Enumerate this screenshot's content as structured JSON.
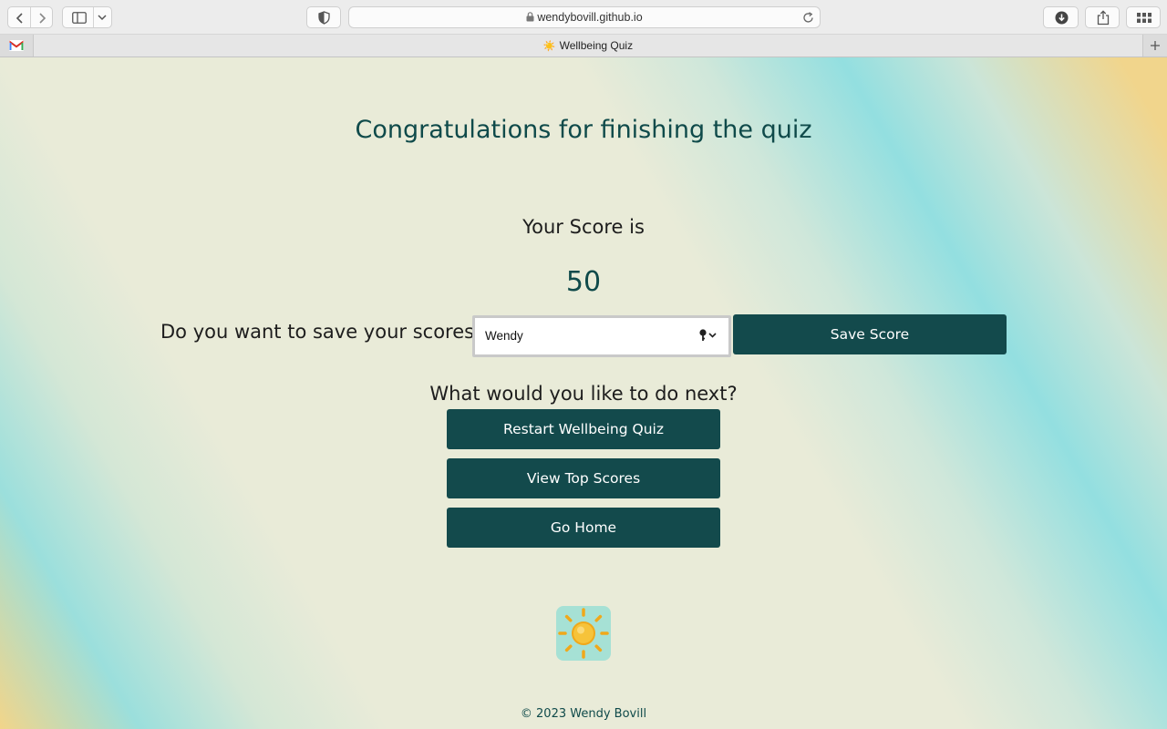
{
  "browser": {
    "url": "wendybovill.github.io",
    "tab_title": "Wellbeing Quiz",
    "tab_favicon": "☀️"
  },
  "quiz": {
    "heading": "Congratulations for finishing the quiz",
    "score_label": "Your Score is",
    "score_value": "50",
    "save_prompt": "Do you want to save your scores?",
    "name_value": "Wendy",
    "save_button": "Save Score",
    "next_label": "What would you like to do next?",
    "restart_button": "Restart Wellbeing Quiz",
    "top_scores_button": "View Top Scores",
    "home_button": "Go Home"
  },
  "footer": {
    "copyright": "© 2023 Wendy Bovill"
  },
  "icons": [
    "back-icon",
    "forward-icon",
    "sidebar-icon",
    "chevron-down-icon",
    "shield-icon",
    "lock-icon",
    "reload-icon",
    "download-icon",
    "share-icon",
    "tab-overview-icon",
    "gmail-icon",
    "new-tab-icon",
    "key-icon",
    "sun-icon"
  ],
  "colors": {
    "primary": "#134a4c",
    "heading": "#0f4a4a",
    "background": "#e9ebd8",
    "accent_teal": "#93dfe0",
    "accent_yellow": "#f2d58a"
  }
}
